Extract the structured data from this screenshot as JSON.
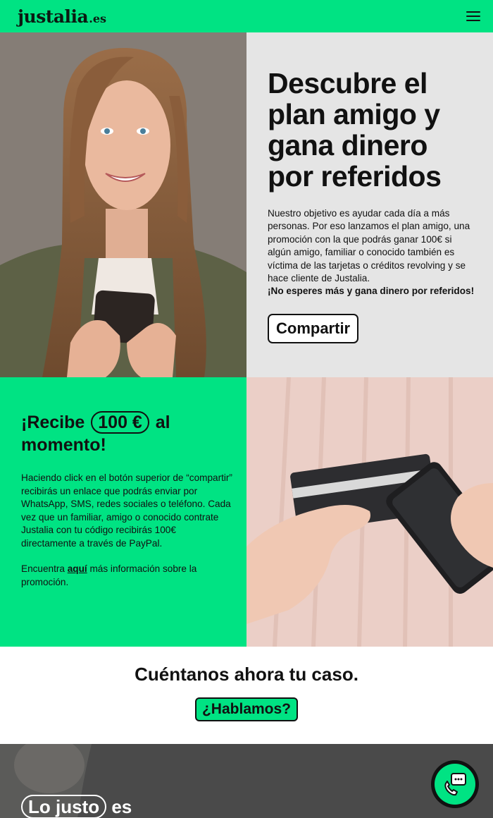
{
  "header": {
    "logo_main": "justalia",
    "logo_tld": ".es"
  },
  "hero": {
    "title": "Descubre el plan amigo y gana dinero por referidos",
    "paragraph": "Nuestro objetivo es ayudar cada día a más personas. Por eso lanzamos el plan amigo, una promoción con la que podrás ganar 100€ si algún amigo, familiar o conocido también es víctima de las tarjetas o créditos revolving y se hace cliente de Justalia.",
    "strong": "¡No esperes más y gana dinero por referidos!",
    "button": "Compartir"
  },
  "reward": {
    "title_pre": "¡Recibe",
    "amount": "100 €",
    "title_post_1": "al",
    "title_post_2": "momento!",
    "paragraph": "Haciendo click en el botón superior de “compartir” recibirás un enlace que podrás enviar por WhatsApp, SMS, redes sociales o teléfono. Cada vez que un familiar, amigo o conocido contrate Justalia con tu código recibirás 100€ directamente a través de PayPal.",
    "info_pre": "Encuentra ",
    "info_link": "aquí",
    "info_post": " más información sobre la promoción."
  },
  "cta": {
    "title": "Cuéntanos ahora tu caso.",
    "button": "¿Hablamos?"
  },
  "bottom": {
    "pill": "Lo justo",
    "rest": "es"
  },
  "colors": {
    "brand_green": "#00e383",
    "dark": "#111111",
    "light_gray": "#e5e5e5"
  },
  "icons": [
    "hamburger-menu-icon",
    "chat-phone-icon"
  ]
}
